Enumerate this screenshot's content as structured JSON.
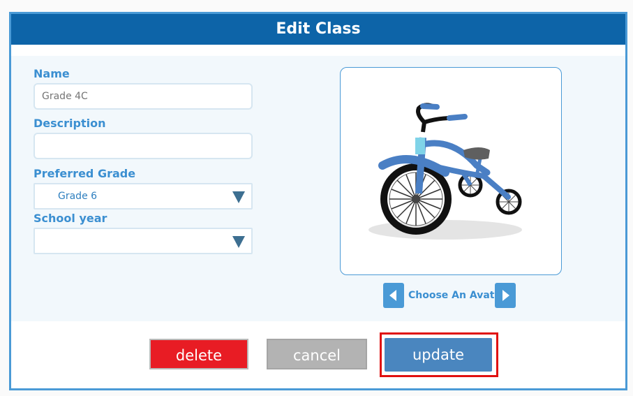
{
  "dialog": {
    "title": "Edit Class"
  },
  "form": {
    "name_label": "Name",
    "name_placeholder": "Grade 4C",
    "description_label": "Description",
    "description_value": "",
    "preferred_grade_label": "Preferred Grade",
    "preferred_grade_value": "Grade 6",
    "school_year_label": "School year",
    "school_year_value": ""
  },
  "avatar": {
    "icon": "tricycle-icon",
    "choose_label": "Choose An Avatar",
    "prev_icon": "chevron-left-icon",
    "next_icon": "chevron-right-icon"
  },
  "actions": {
    "delete_label": "delete",
    "cancel_label": "cancel",
    "update_label": "update"
  },
  "colors": {
    "titlebar": "#0d64a8",
    "accent": "#3b8fd1",
    "delete": "#e81c24",
    "cancel": "#b3b3b3",
    "update": "#4a86bf",
    "highlight": "#e01010"
  }
}
